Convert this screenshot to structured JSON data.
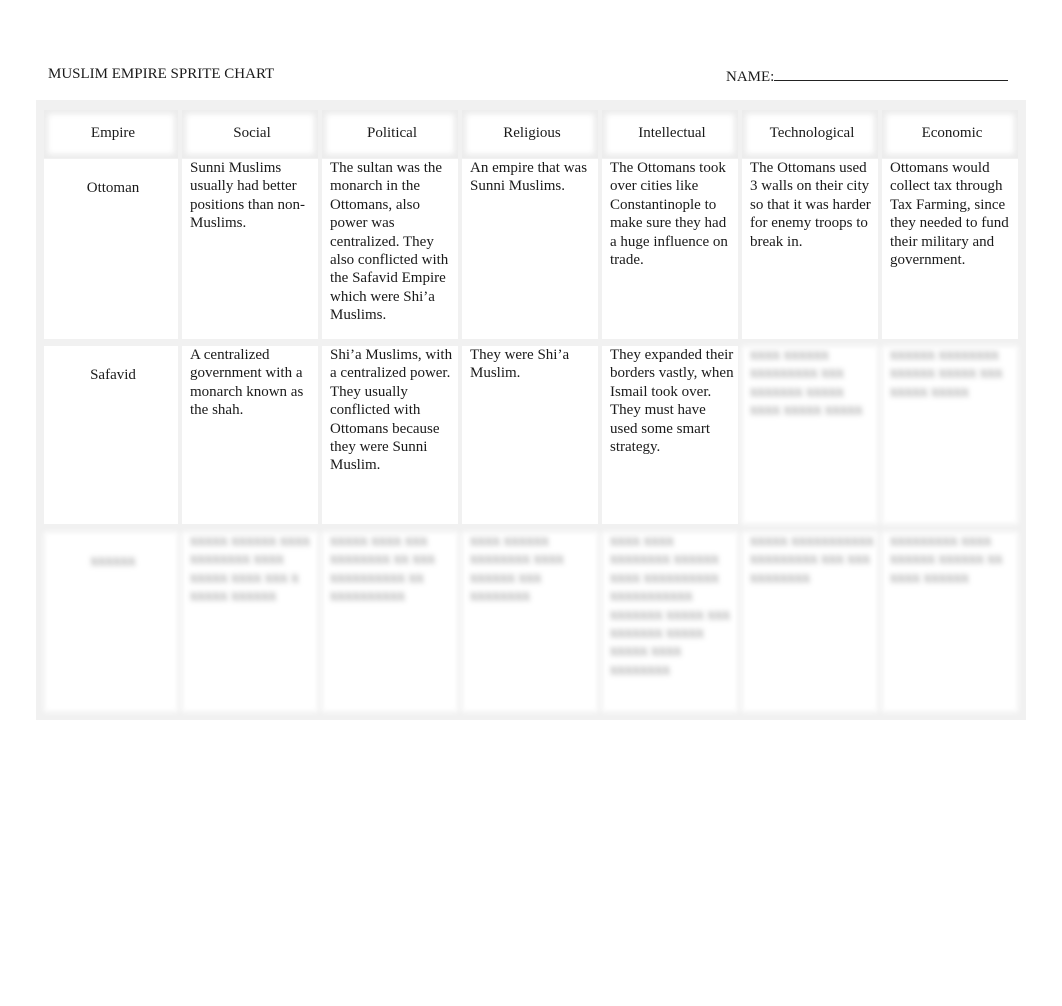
{
  "header": {
    "title": "MUSLIM EMPIRE SPRITE CHART",
    "name_label": "NAME:"
  },
  "table": {
    "columns": [
      "Empire",
      "Social",
      "Political",
      "Religious",
      "Intellectual",
      "Technological",
      "Economic"
    ],
    "rows": [
      {
        "empire": "Ottoman",
        "social": "Sunni Muslims usually had better positions than non-Muslims.",
        "political": "The sultan was the monarch in the Ottomans, also power was centralized. They also conflicted with the Safavid Empire which were Shi’a Muslims.",
        "religious": "An empire that was Sunni Muslims.",
        "intellectual": "The Ottomans took over cities like Constantinople to make sure they had a huge influence on trade.",
        "technological": "The Ottomans used 3 walls on their city so that it was harder for enemy troops to break in.",
        "economic": "Ottomans would collect tax through Tax Farming, since they needed to fund their military and government."
      },
      {
        "empire": "Safavid",
        "social": "A centralized government with a monarch known as the shah.",
        "political": "Shi’a Muslims, with a centralized power. They usually conflicted with Ottomans because they were Sunni Muslim.",
        "religious": "They were Shi’a Muslim.",
        "intellectual": "They expanded their borders vastly, when Ismail took over. They must have used some smart strategy.",
        "technological": "xxxx xxxxxx xxxxxxxxx xxx xxxxxxx xxxxx xxxx xxxxx xxxxx",
        "economic": "xxxxxx xxxxxxxx xxxxxx xxxxx xxx xxxxx xxxxx"
      },
      {
        "empire": "xxxxxx",
        "social": "xxxxx xxxxxx xxxx xxxxxxxx xxxx xxxxx xxxx xxx x xxxxx xxxxxx",
        "political": "xxxxx xxxx xxx xxxxxxxx xx xxx xxxxxxxxxx xx xxxxxxxxxx",
        "religious": "xxxx xxxxxx xxxxxxxx xxxx xxxxxx xxx xxxxxxxx",
        "intellectual": "xxxx xxxx xxxxxxxx xxxxxx xxxx xxxxxxxxxx xxxxxxxxxxx xxxxxxx xxxxx xxx xxxxxxx xxxxx xxxxx xxxx xxxxxxxx",
        "technological": "xxxxx xxxxxxxxxxx xxxxxxxxx xxx xxx xxxxxxxx",
        "economic": "xxxxxxxxx xxxx xxxxxx xxxxxx xx xxxx xxxxxx"
      }
    ]
  }
}
